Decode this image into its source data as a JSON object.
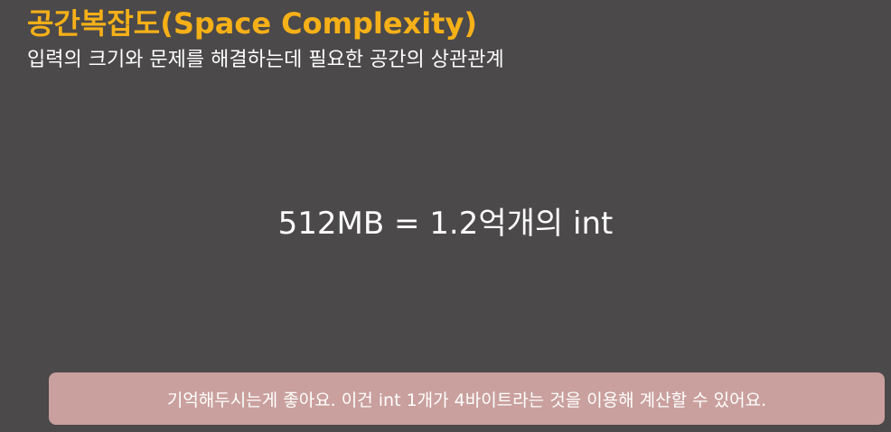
{
  "slide": {
    "title": "공간복잡도(Space Complexity)",
    "subtitle": "입력의 크기와 문제를 해결하는데 필요한 공간의 상관관계",
    "formula": "512MB = 1.2억개의 int"
  },
  "caption": {
    "text": "기억해두시는게 좋아요. 이건 int 1개가 4바이트라는 것을 이용해 계산할 수 있어요."
  },
  "colors": {
    "background": "#4b494a",
    "title": "#f6b018",
    "text": "#ffffff",
    "caption_bg": "#c9a09d"
  }
}
